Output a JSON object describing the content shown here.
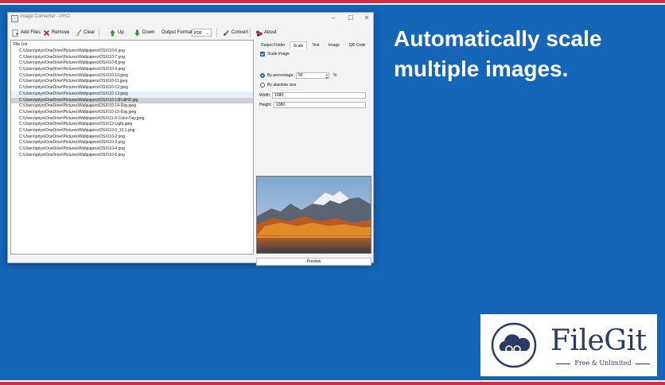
{
  "headline": "Automatically scale multiple images.",
  "window": {
    "title": "Image Converter - PRO",
    "minimize_glyph": "–",
    "maximize_glyph": "☐",
    "close_glyph": "✕"
  },
  "toolbar": {
    "add_files": "Add Files",
    "remove": "Remove",
    "clear": "Clear",
    "up": "Up",
    "down": "Down",
    "output_format_label": "Output Format:",
    "output_format_value": "PDF",
    "convert": "Convert",
    "about": "About"
  },
  "file_list": {
    "header": "File List",
    "files": [
      "C:\\Users\\priyo\\OneDrive\\Pictures\\Wallpapers\\OSX\\10-6.png",
      "C:\\Users\\priyo\\OneDrive\\Pictures\\Wallpapers\\OSX\\10-7.png",
      "C:\\Users\\priyo\\OneDrive\\Pictures\\Wallpapers\\OSX\\10-8.png",
      "C:\\Users\\priyo\\OneDrive\\Pictures\\Wallpapers\\OSX\\10-9.png",
      "C:\\Users\\priyo\\OneDrive\\Pictures\\Wallpapers\\OSX\\10-10.jpeg",
      "C:\\Users\\priyo\\OneDrive\\Pictures\\Wallpapers\\OSX\\10-11.jpeg",
      "C:\\Users\\priyo\\OneDrive\\Pictures\\Wallpapers\\OSX\\10-12.jpeg",
      "C:\\Users\\priyo\\OneDrive\\Pictures\\Wallpapers\\OSX\\10-13.jpeg",
      "C:\\Users\\priyo\\OneDrive\\Pictures\\Wallpapers\\OSX\\10-13FullHD.jpg",
      "C:\\Users\\priyo\\OneDrive\\Pictures\\Wallpapers\\OSX\\10-14-Day.jpeg",
      "C:\\Users\\priyo\\OneDrive\\Pictures\\Wallpapers\\OSX\\10-15-Day.jpeg",
      "C:\\Users\\priyo\\OneDrive\\Pictures\\Wallpapers\\OSX\\11-0-Color-Day.jpeg",
      "C:\\Users\\priyo\\OneDrive\\Pictures\\Wallpapers\\OSX\\12-Light.jpeg",
      "C:\\Users\\priyo\\OneDrive\\Pictures\\Wallpapers\\OSX\\10-0_10.1.png",
      "C:\\Users\\priyo\\OneDrive\\Pictures\\Wallpapers\\OSX\\10-2.png",
      "C:\\Users\\priyo\\OneDrive\\Pictures\\Wallpapers\\OSX\\10-3.png",
      "C:\\Users\\priyo\\OneDrive\\Pictures\\Wallpapers\\OSX\\10-4.png",
      "C:\\Users\\priyo\\OneDrive\\Pictures\\Wallpapers\\OSX\\10-5.png"
    ],
    "hover_index": 7,
    "selected_index": 8
  },
  "tabs": {
    "output_folder": "Output Folder",
    "scale": "Scale",
    "text": "Text",
    "image": "Image",
    "qr_code": "QR Code",
    "active": "Scale"
  },
  "scale": {
    "scale_image_label": "Scale Image",
    "scale_image_checked": true,
    "by_percentage_label": "By percentage:",
    "percentage_value": "50",
    "percent_unit": "%",
    "by_absolute_label": "By absolute size",
    "width_label": "Width:",
    "width_value": "1080",
    "height_label": "Height:",
    "height_value": "1080"
  },
  "preview": {
    "button_label": "Preview"
  },
  "logo": {
    "name": "FileGit",
    "tagline": "Free & Unlimited"
  },
  "colors": {
    "background": "#1565b8",
    "stripe": "#c9304a",
    "accent": "#1f5fbf",
    "logo_text": "#2b3a67"
  }
}
